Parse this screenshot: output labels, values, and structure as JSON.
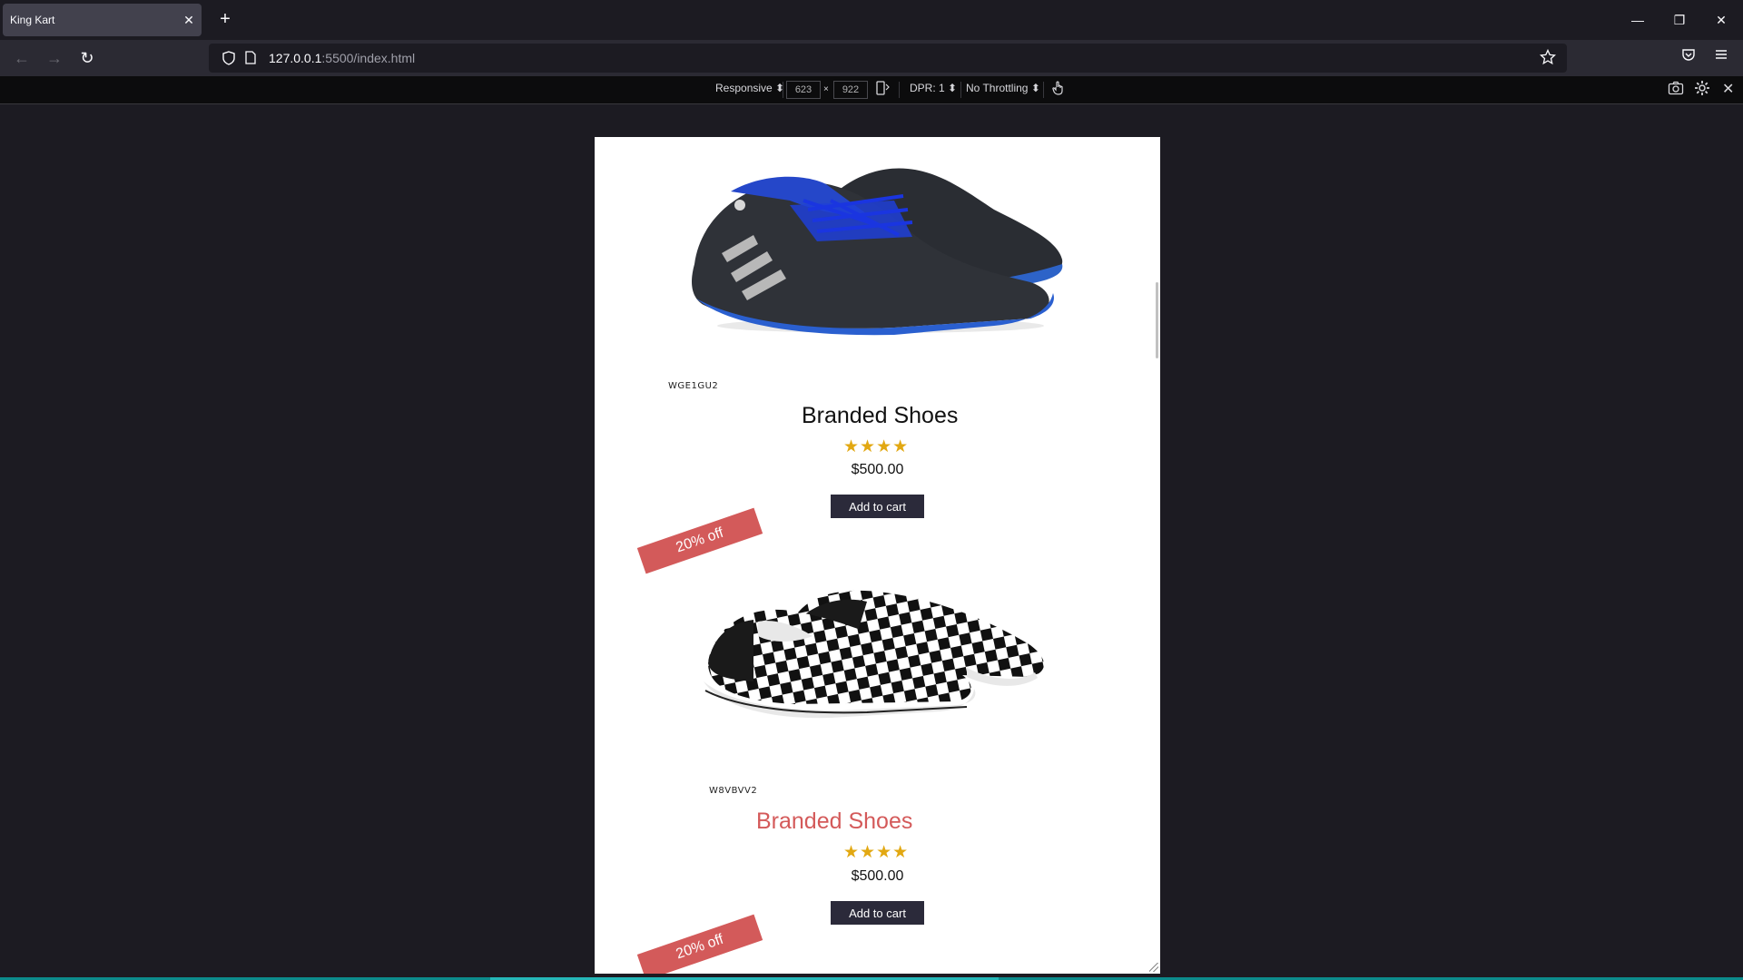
{
  "browser": {
    "tab_title": "King Kart",
    "tab_close": "✕",
    "new_tab": "+",
    "window_controls": [
      "—",
      "❐",
      "✕"
    ],
    "nav": {
      "back": "←",
      "forward": "→",
      "reload": "↻"
    },
    "url_host": "127.0.0.1",
    "url_path": ":5500/index.html",
    "icons": {
      "shield": "shield-icon",
      "page": "page-icon",
      "star": "bookmark-star-icon",
      "pocket": "pocket-icon",
      "menu": "hamburger-menu-icon"
    }
  },
  "rdm": {
    "device": "Responsive ⬍",
    "width": "623",
    "times": "×",
    "height": "922",
    "dpr": "DPR: 1 ⬍",
    "throttling": "No Throttling ⬍"
  },
  "products": [
    {
      "sku": "WGE1GU2",
      "title": "Branded Shoes",
      "stars": "★★★★",
      "price": "$500.00",
      "cta": "Add to cart",
      "badge": "20% off",
      "shoe": "sneaker-black-blue"
    },
    {
      "sku": "W8VBVV2",
      "title": "Branded Shoes",
      "stars": "★★★★",
      "price": "$500.00",
      "cta": "Add to cart",
      "badge": "20% off",
      "shoe": "slip-on-checkered"
    }
  ],
  "colors": {
    "accent": "#d35a5a",
    "star": "#e2a812",
    "button": "#2b2a3a",
    "chrome_bg": "#1c1b22"
  }
}
